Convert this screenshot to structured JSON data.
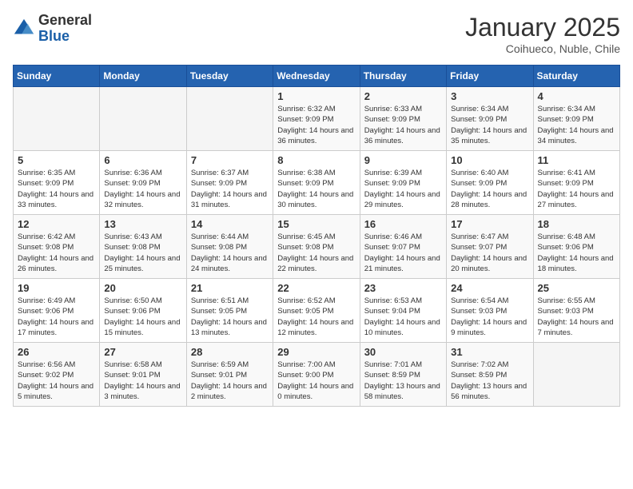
{
  "header": {
    "logo_general": "General",
    "logo_blue": "Blue",
    "month_title": "January 2025",
    "subtitle": "Coihueco, Nuble, Chile"
  },
  "days_of_week": [
    "Sunday",
    "Monday",
    "Tuesday",
    "Wednesday",
    "Thursday",
    "Friday",
    "Saturday"
  ],
  "weeks": [
    [
      {
        "day": "",
        "sunrise": "",
        "sunset": "",
        "daylight": ""
      },
      {
        "day": "",
        "sunrise": "",
        "sunset": "",
        "daylight": ""
      },
      {
        "day": "",
        "sunrise": "",
        "sunset": "",
        "daylight": ""
      },
      {
        "day": "1",
        "sunrise": "Sunrise: 6:32 AM",
        "sunset": "Sunset: 9:09 PM",
        "daylight": "Daylight: 14 hours and 36 minutes."
      },
      {
        "day": "2",
        "sunrise": "Sunrise: 6:33 AM",
        "sunset": "Sunset: 9:09 PM",
        "daylight": "Daylight: 14 hours and 36 minutes."
      },
      {
        "day": "3",
        "sunrise": "Sunrise: 6:34 AM",
        "sunset": "Sunset: 9:09 PM",
        "daylight": "Daylight: 14 hours and 35 minutes."
      },
      {
        "day": "4",
        "sunrise": "Sunrise: 6:34 AM",
        "sunset": "Sunset: 9:09 PM",
        "daylight": "Daylight: 14 hours and 34 minutes."
      }
    ],
    [
      {
        "day": "5",
        "sunrise": "Sunrise: 6:35 AM",
        "sunset": "Sunset: 9:09 PM",
        "daylight": "Daylight: 14 hours and 33 minutes."
      },
      {
        "day": "6",
        "sunrise": "Sunrise: 6:36 AM",
        "sunset": "Sunset: 9:09 PM",
        "daylight": "Daylight: 14 hours and 32 minutes."
      },
      {
        "day": "7",
        "sunrise": "Sunrise: 6:37 AM",
        "sunset": "Sunset: 9:09 PM",
        "daylight": "Daylight: 14 hours and 31 minutes."
      },
      {
        "day": "8",
        "sunrise": "Sunrise: 6:38 AM",
        "sunset": "Sunset: 9:09 PM",
        "daylight": "Daylight: 14 hours and 30 minutes."
      },
      {
        "day": "9",
        "sunrise": "Sunrise: 6:39 AM",
        "sunset": "Sunset: 9:09 PM",
        "daylight": "Daylight: 14 hours and 29 minutes."
      },
      {
        "day": "10",
        "sunrise": "Sunrise: 6:40 AM",
        "sunset": "Sunset: 9:09 PM",
        "daylight": "Daylight: 14 hours and 28 minutes."
      },
      {
        "day": "11",
        "sunrise": "Sunrise: 6:41 AM",
        "sunset": "Sunset: 9:09 PM",
        "daylight": "Daylight: 14 hours and 27 minutes."
      }
    ],
    [
      {
        "day": "12",
        "sunrise": "Sunrise: 6:42 AM",
        "sunset": "Sunset: 9:08 PM",
        "daylight": "Daylight: 14 hours and 26 minutes."
      },
      {
        "day": "13",
        "sunrise": "Sunrise: 6:43 AM",
        "sunset": "Sunset: 9:08 PM",
        "daylight": "Daylight: 14 hours and 25 minutes."
      },
      {
        "day": "14",
        "sunrise": "Sunrise: 6:44 AM",
        "sunset": "Sunset: 9:08 PM",
        "daylight": "Daylight: 14 hours and 24 minutes."
      },
      {
        "day": "15",
        "sunrise": "Sunrise: 6:45 AM",
        "sunset": "Sunset: 9:08 PM",
        "daylight": "Daylight: 14 hours and 22 minutes."
      },
      {
        "day": "16",
        "sunrise": "Sunrise: 6:46 AM",
        "sunset": "Sunset: 9:07 PM",
        "daylight": "Daylight: 14 hours and 21 minutes."
      },
      {
        "day": "17",
        "sunrise": "Sunrise: 6:47 AM",
        "sunset": "Sunset: 9:07 PM",
        "daylight": "Daylight: 14 hours and 20 minutes."
      },
      {
        "day": "18",
        "sunrise": "Sunrise: 6:48 AM",
        "sunset": "Sunset: 9:06 PM",
        "daylight": "Daylight: 14 hours and 18 minutes."
      }
    ],
    [
      {
        "day": "19",
        "sunrise": "Sunrise: 6:49 AM",
        "sunset": "Sunset: 9:06 PM",
        "daylight": "Daylight: 14 hours and 17 minutes."
      },
      {
        "day": "20",
        "sunrise": "Sunrise: 6:50 AM",
        "sunset": "Sunset: 9:06 PM",
        "daylight": "Daylight: 14 hours and 15 minutes."
      },
      {
        "day": "21",
        "sunrise": "Sunrise: 6:51 AM",
        "sunset": "Sunset: 9:05 PM",
        "daylight": "Daylight: 14 hours and 13 minutes."
      },
      {
        "day": "22",
        "sunrise": "Sunrise: 6:52 AM",
        "sunset": "Sunset: 9:05 PM",
        "daylight": "Daylight: 14 hours and 12 minutes."
      },
      {
        "day": "23",
        "sunrise": "Sunrise: 6:53 AM",
        "sunset": "Sunset: 9:04 PM",
        "daylight": "Daylight: 14 hours and 10 minutes."
      },
      {
        "day": "24",
        "sunrise": "Sunrise: 6:54 AM",
        "sunset": "Sunset: 9:03 PM",
        "daylight": "Daylight: 14 hours and 9 minutes."
      },
      {
        "day": "25",
        "sunrise": "Sunrise: 6:55 AM",
        "sunset": "Sunset: 9:03 PM",
        "daylight": "Daylight: 14 hours and 7 minutes."
      }
    ],
    [
      {
        "day": "26",
        "sunrise": "Sunrise: 6:56 AM",
        "sunset": "Sunset: 9:02 PM",
        "daylight": "Daylight: 14 hours and 5 minutes."
      },
      {
        "day": "27",
        "sunrise": "Sunrise: 6:58 AM",
        "sunset": "Sunset: 9:01 PM",
        "daylight": "Daylight: 14 hours and 3 minutes."
      },
      {
        "day": "28",
        "sunrise": "Sunrise: 6:59 AM",
        "sunset": "Sunset: 9:01 PM",
        "daylight": "Daylight: 14 hours and 2 minutes."
      },
      {
        "day": "29",
        "sunrise": "Sunrise: 7:00 AM",
        "sunset": "Sunset: 9:00 PM",
        "daylight": "Daylight: 14 hours and 0 minutes."
      },
      {
        "day": "30",
        "sunrise": "Sunrise: 7:01 AM",
        "sunset": "Sunset: 8:59 PM",
        "daylight": "Daylight: 13 hours and 58 minutes."
      },
      {
        "day": "31",
        "sunrise": "Sunrise: 7:02 AM",
        "sunset": "Sunset: 8:59 PM",
        "daylight": "Daylight: 13 hours and 56 minutes."
      },
      {
        "day": "",
        "sunrise": "",
        "sunset": "",
        "daylight": ""
      }
    ]
  ]
}
